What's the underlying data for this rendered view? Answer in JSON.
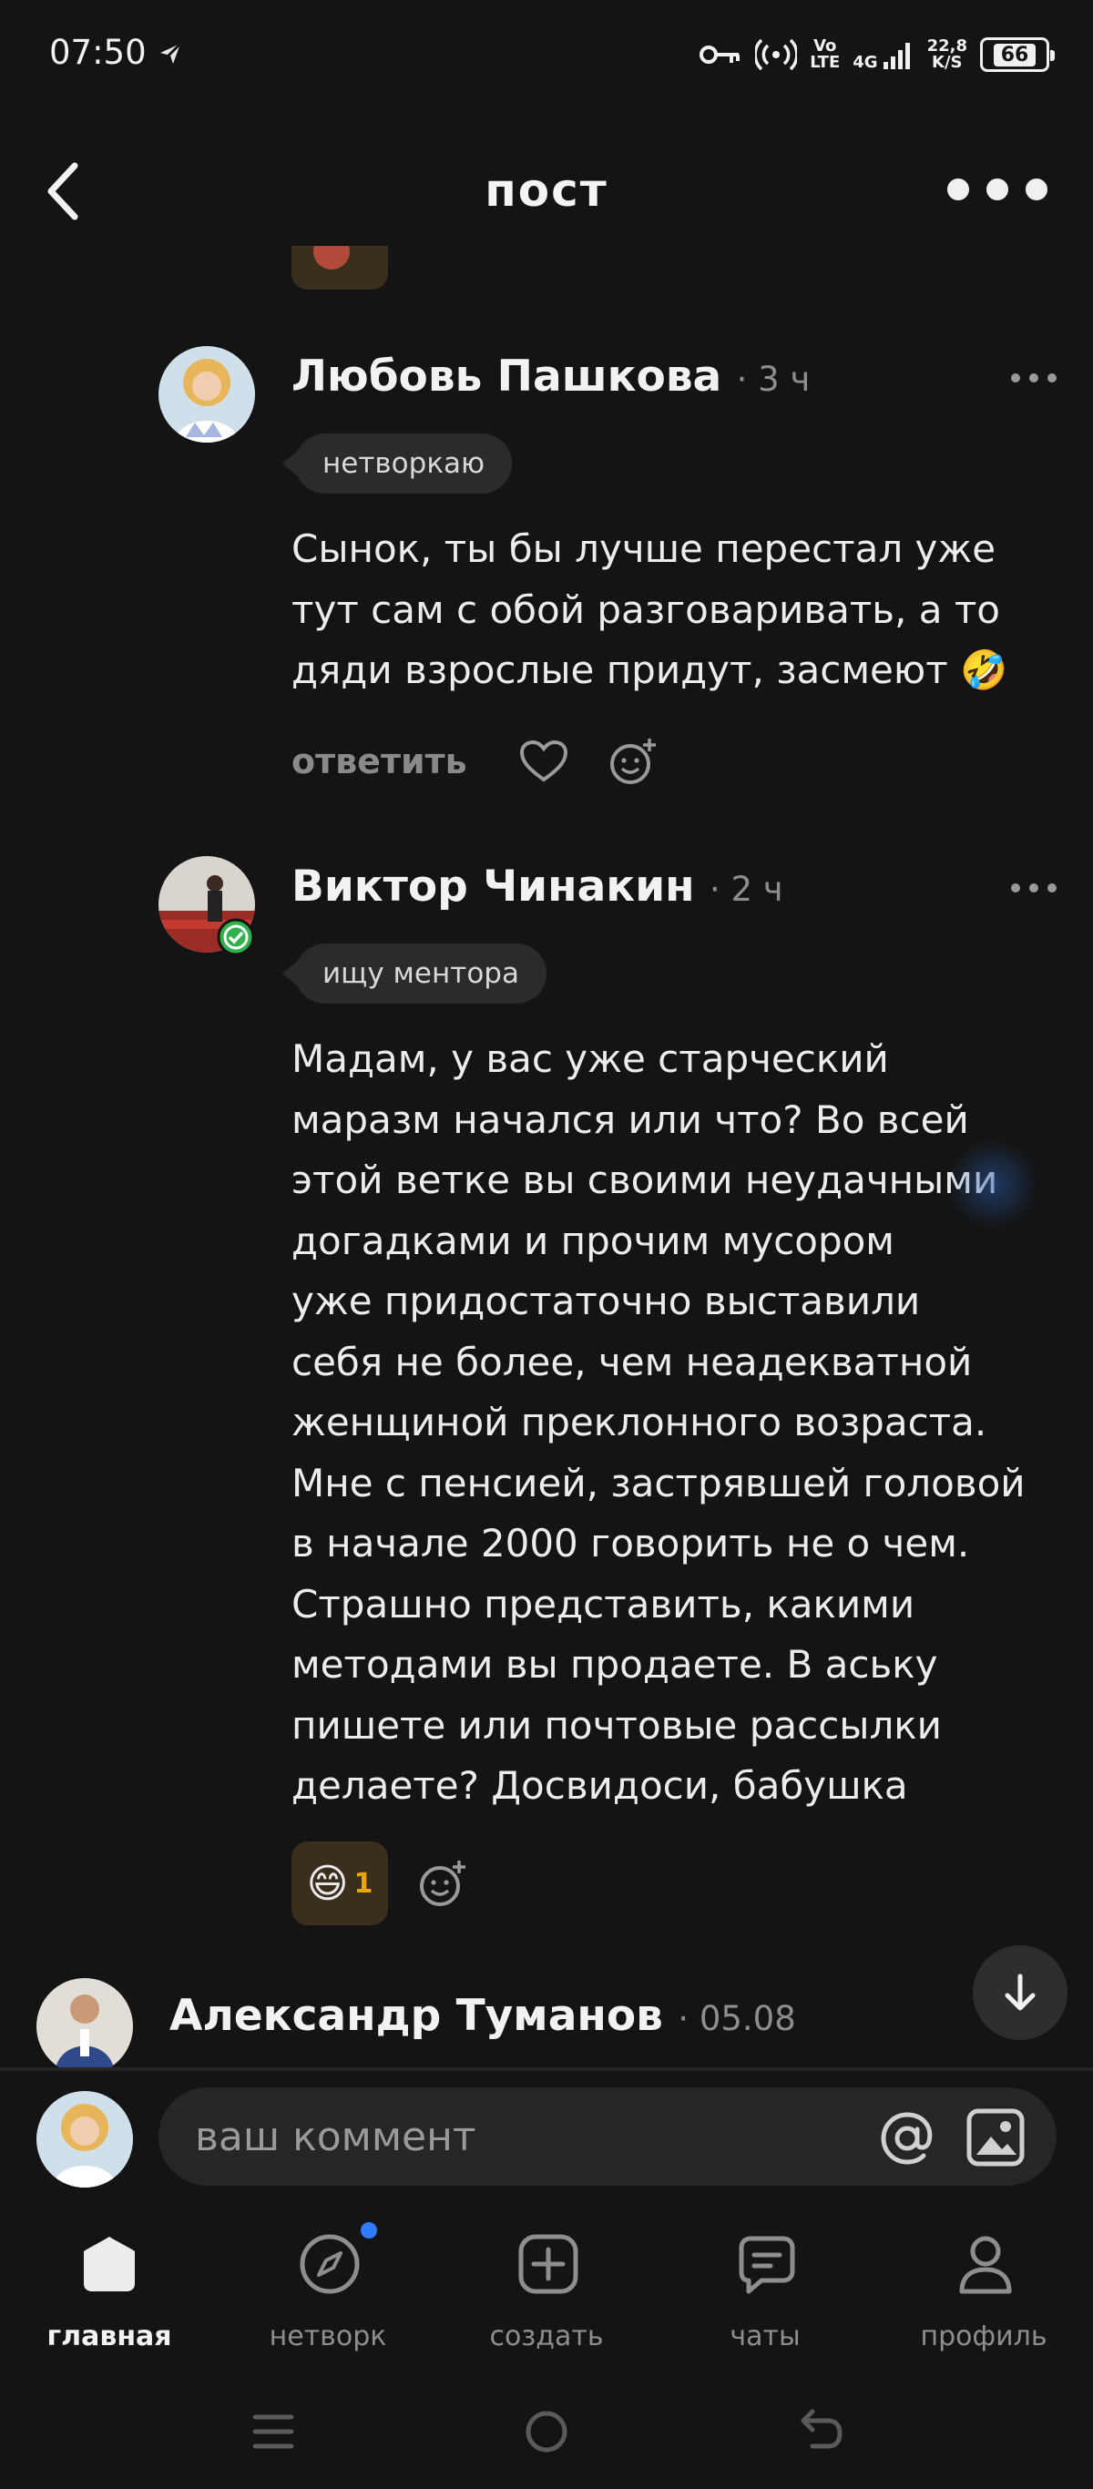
{
  "status_bar": {
    "time": "07:50",
    "net_volte_top": "Vo",
    "net_volte_bottom": "LTE",
    "net_4g": "4G",
    "speed_top": "22,8",
    "speed_bottom": "K/S",
    "battery": "66"
  },
  "header": {
    "title": "пост"
  },
  "comments": [
    {
      "author": "Любовь Пашкова",
      "time": "· 3 ч",
      "tag": "нетворкаю",
      "text": "Сынок, ты бы лучше перестал уже\nтут сам с обой разговаривать, а то\nдяди взрослые придут, засмеют 🤣",
      "reply_label": "ответить"
    },
    {
      "author": "Виктор Чинакин",
      "time": "· 2 ч",
      "tag": "ищу ментора",
      "text": "Мадам, у вас уже старческий\nмаразм начался или что? Во всей\nэтой ветке вы своими неудачными\nдогадками и прочим мусором\nуже придостаточно выставили\nсебя не более, чем неадекватной\nженщиной преклонного возраста.\nМне с пенсией, застрявшей головой\nв начале 2000 говорить не о чем.\nСтрашно представить, какими\nметодами вы продаете. В аську\nпишете или почтовые рассылки\nделаете? Досвидоси, бабушка",
      "reaction_emoji": "😄",
      "reaction_count": "1"
    },
    {
      "author": "Александр Туманов",
      "time": "· 05.08"
    }
  ],
  "composer": {
    "placeholder": "ваш коммент"
  },
  "bottom_nav": [
    {
      "label": "главная",
      "icon": "home-icon"
    },
    {
      "label": "нетворк",
      "icon": "compass-icon"
    },
    {
      "label": "создать",
      "icon": "plus-square-icon"
    },
    {
      "label": "чаты",
      "icon": "chat-icon"
    },
    {
      "label": "профиль",
      "icon": "profile-icon"
    }
  ],
  "colors": {
    "background": "#141414",
    "accent_blue": "#2f7bff",
    "reaction_bg": "#3a2e1c",
    "reaction_count": "#f0a500",
    "verified_green": "#2fb24c"
  }
}
